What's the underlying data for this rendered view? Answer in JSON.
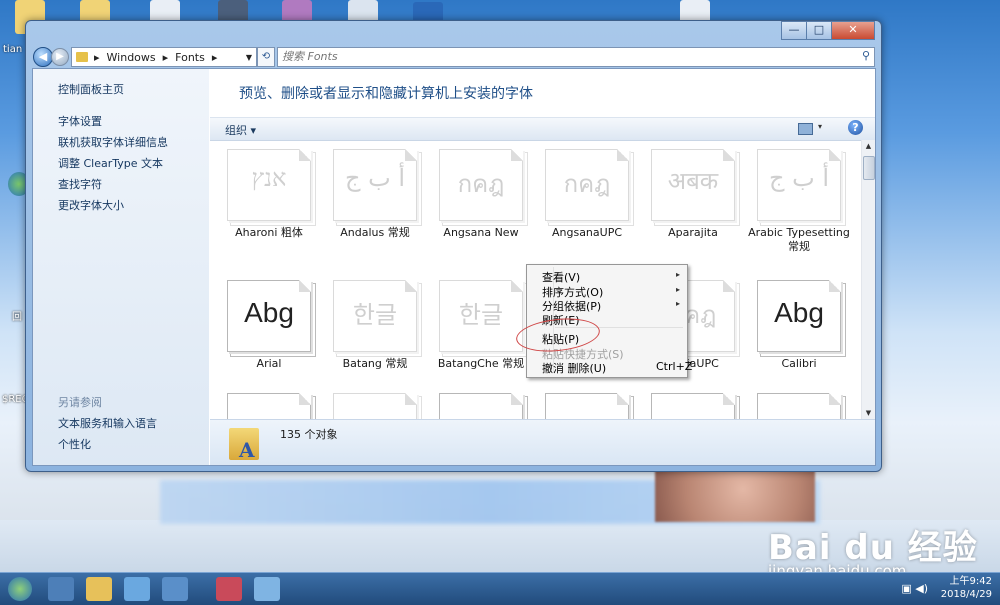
{
  "desktop": {
    "labels": [
      "tian",
      "回",
      "$REC"
    ]
  },
  "address_bar": {
    "crumbs": [
      "Windows",
      "Fonts"
    ],
    "separator": "▸",
    "search_placeholder": "搜索 Fonts"
  },
  "window": {
    "controls": [
      "—",
      "□",
      "✕"
    ]
  },
  "left_pane": {
    "main_link": "控制面板主页",
    "links": [
      "字体设置",
      "联机获取字体详细信息",
      "调整 ClearType 文本",
      "查找字符",
      "更改字体大小"
    ],
    "see_also_header": "另请参阅",
    "see_also_links": [
      "文本服务和输入语言",
      "个性化"
    ]
  },
  "main": {
    "heading": "预览、删除或者显示和隐藏计算机上安装的字体",
    "organize_label": "组织",
    "fonts": [
      {
        "name": "Aharoni 粗体",
        "glyph": "אנץ",
        "hidden": true
      },
      {
        "name": "Andalus 常规",
        "glyph": "أ ب ج",
        "hidden": true
      },
      {
        "name": "Angsana New",
        "glyph": "กคฎ",
        "hidden": true
      },
      {
        "name": "AngsanaUPC",
        "glyph": "กคฎ",
        "hidden": true
      },
      {
        "name": "Aparajita",
        "glyph": "अबक",
        "hidden": true
      },
      {
        "name": "Arabic Typesetting 常规",
        "glyph": "أ ب ج",
        "hidden": true
      },
      {
        "name": "Arial",
        "glyph": "Abg",
        "hidden": false
      },
      {
        "name": "Batang 常规",
        "glyph": "한글",
        "hidden": true
      },
      {
        "name": "BatangChe 常规",
        "glyph": "한글",
        "hidden": true
      },
      {
        "name": "",
        "glyph": "",
        "hidden": true
      },
      {
        "name": "valliaUPC",
        "glyph": "กคฎ",
        "hidden": true
      },
      {
        "name": "Calibri",
        "glyph": "Abg",
        "hidden": false
      }
    ],
    "status": "135 个对象"
  },
  "context_menu": {
    "items": [
      {
        "label": "查看(V)",
        "submenu": true,
        "disabled": false
      },
      {
        "label": "排序方式(O)",
        "submenu": true,
        "disabled": false
      },
      {
        "label": "分组依据(P)",
        "submenu": true,
        "disabled": false
      },
      {
        "label": "刷新(E)",
        "submenu": false,
        "disabled": false
      },
      {
        "label": "粘贴(P)",
        "submenu": false,
        "disabled": false
      },
      {
        "label": "粘贴快捷方式(S)",
        "submenu": false,
        "disabled": true
      },
      {
        "label": "撤消 删除(U)",
        "submenu": false,
        "disabled": false,
        "shortcut": "Ctrl+Z"
      }
    ]
  },
  "watermark": {
    "logo": "Bai du 经验",
    "url": "jingyan.baidu.com"
  },
  "taskbar": {
    "time": "上午9:42",
    "date": "2018/4/29"
  },
  "colors": {
    "accent": "#1f4f88",
    "circle": "#d04848",
    "link": "#14365f"
  }
}
